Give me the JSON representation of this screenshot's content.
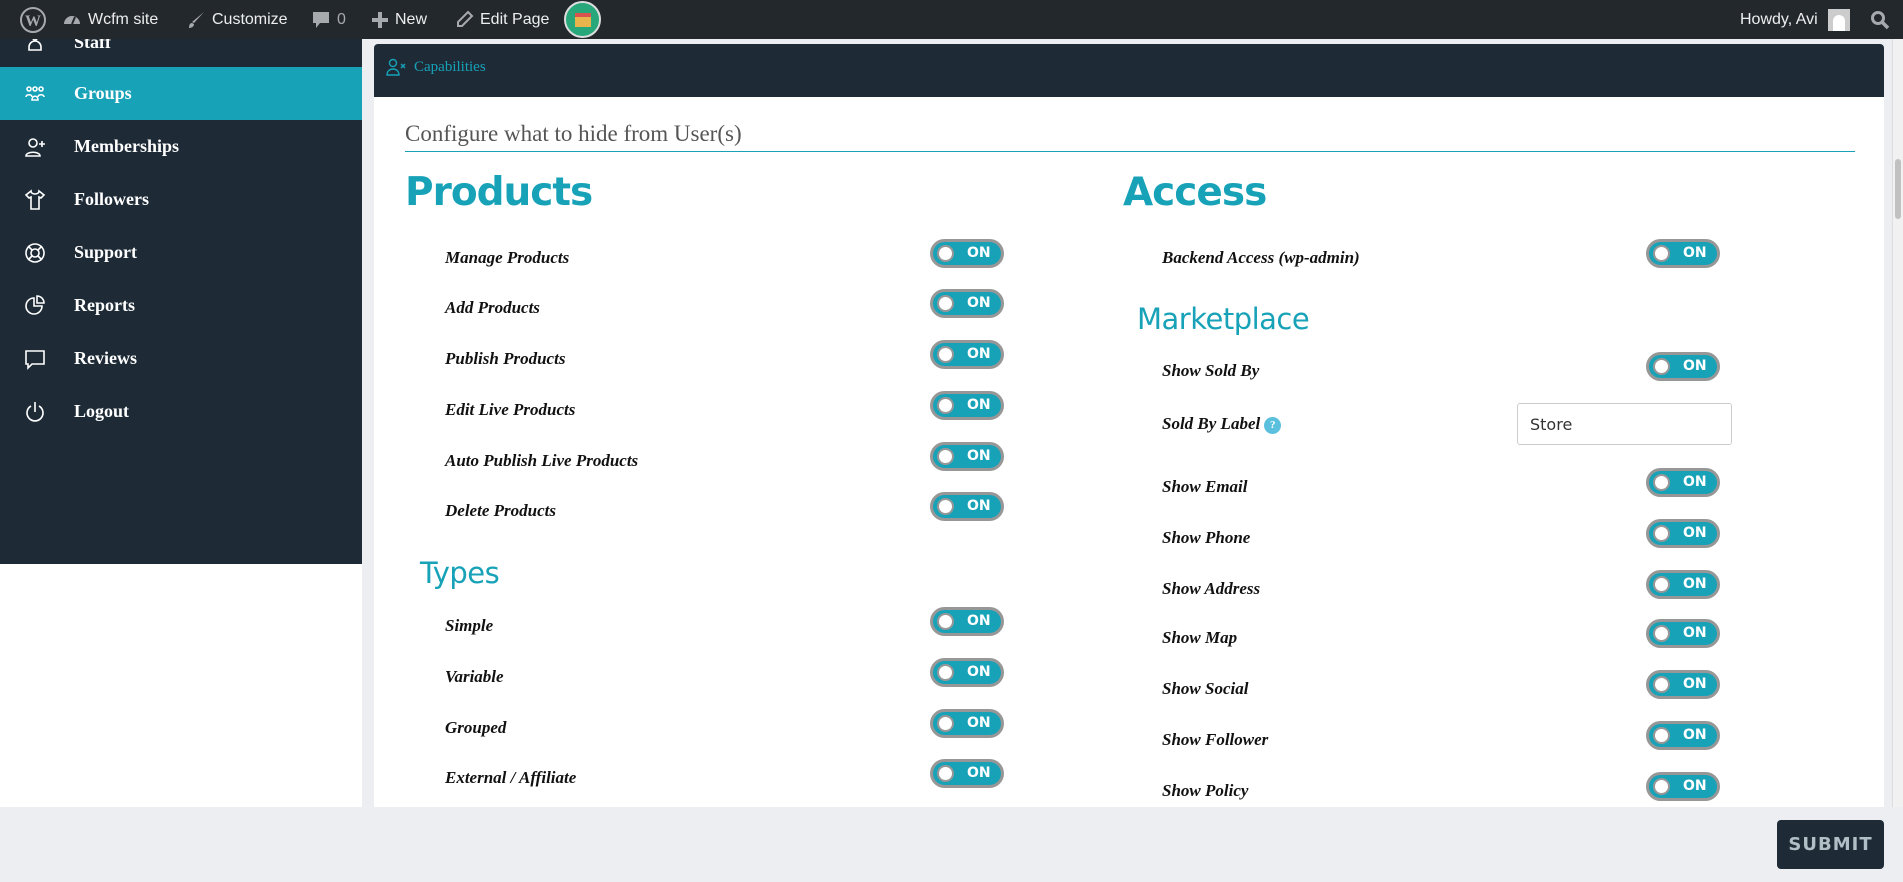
{
  "adminbar": {
    "site_name": "Wcfm site",
    "customize": "Customize",
    "comments_count": "0",
    "new": "New",
    "edit_page": "Edit Page",
    "howdy": "Howdy, Avi"
  },
  "sidebar": {
    "items": [
      {
        "label": "Staff",
        "icon": "staff-icon"
      },
      {
        "label": "Groups",
        "icon": "groups-icon",
        "active": true
      },
      {
        "label": "Memberships",
        "icon": "user-plus-icon"
      },
      {
        "label": "Followers",
        "icon": "shirt-icon"
      },
      {
        "label": "Support",
        "icon": "lifebuoy-icon"
      },
      {
        "label": "Reports",
        "icon": "pie-chart-icon"
      },
      {
        "label": "Reviews",
        "icon": "comment-icon"
      },
      {
        "label": "Logout",
        "icon": "power-icon"
      }
    ]
  },
  "panel": {
    "tab": "Capabilities",
    "config_title": "Configure what to hide from User(s)"
  },
  "products": {
    "heading": "Products",
    "items": [
      {
        "label": "Manage Products",
        "state": "ON"
      },
      {
        "label": "Add Products",
        "state": "ON"
      },
      {
        "label": "Publish Products",
        "state": "ON"
      },
      {
        "label": "Edit Live Products",
        "state": "ON"
      },
      {
        "label": "Auto Publish Live Products",
        "state": "ON"
      },
      {
        "label": "Delete Products",
        "state": "ON"
      }
    ]
  },
  "types": {
    "heading": "Types",
    "items": [
      {
        "label": "Simple",
        "state": "ON"
      },
      {
        "label": "Variable",
        "state": "ON"
      },
      {
        "label": "Grouped",
        "state": "ON"
      },
      {
        "label": "External / Affiliate",
        "state": "ON"
      }
    ]
  },
  "access": {
    "heading": "Access",
    "items": [
      {
        "label": "Backend Access (wp-admin)",
        "state": "ON"
      }
    ]
  },
  "marketplace": {
    "heading": "Marketplace",
    "show_sold_by": {
      "label": "Show Sold By",
      "state": "ON"
    },
    "sold_by_label": {
      "label": "Sold By Label",
      "help_icon": "?",
      "value": "Store"
    },
    "items": [
      {
        "label": "Show Email",
        "state": "ON"
      },
      {
        "label": "Show Phone",
        "state": "ON"
      },
      {
        "label": "Show Address",
        "state": "ON"
      },
      {
        "label": "Show Map",
        "state": "ON"
      },
      {
        "label": "Show Social",
        "state": "ON"
      },
      {
        "label": "Show Follower",
        "state": "ON"
      },
      {
        "label": "Show Policy",
        "state": "ON"
      }
    ]
  },
  "submit_label": "SUBMIT",
  "colors": {
    "accent": "#17a2b8",
    "dark": "#1e2b37",
    "adminbar": "#23282d"
  }
}
